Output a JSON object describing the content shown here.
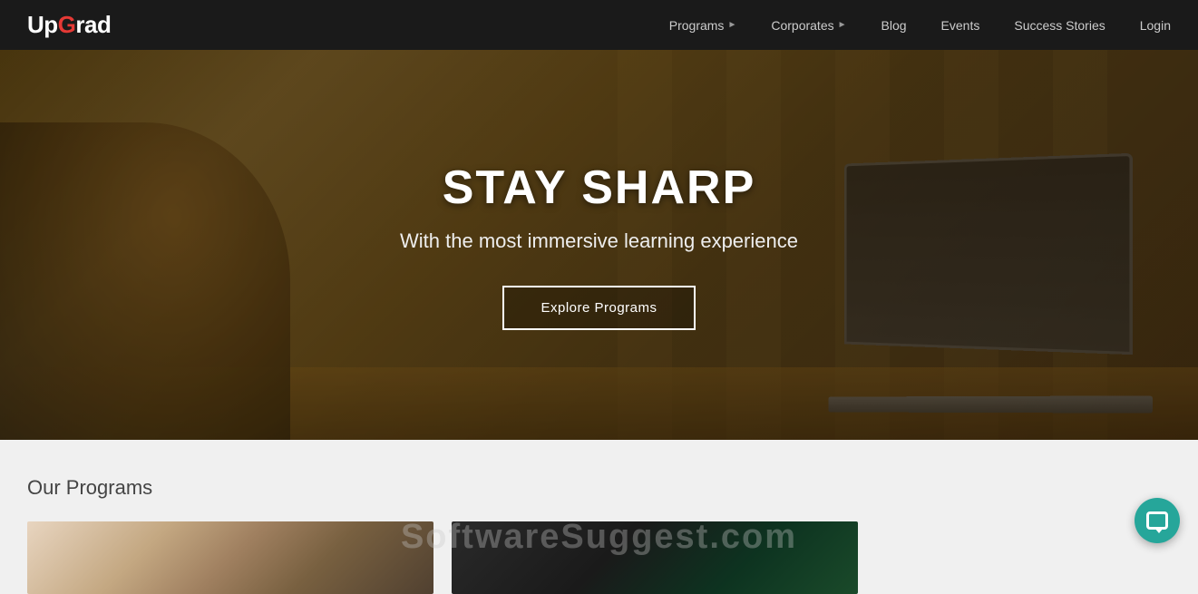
{
  "logo": {
    "part1": "Up",
    "part2": "G",
    "part3": "rad"
  },
  "navbar": {
    "links": [
      {
        "label": "Programs",
        "hasArrow": true,
        "name": "nav-programs"
      },
      {
        "label": "Corporates",
        "hasArrow": true,
        "name": "nav-corporates"
      },
      {
        "label": "Blog",
        "hasArrow": false,
        "name": "nav-blog"
      },
      {
        "label": "Events",
        "hasArrow": false,
        "name": "nav-events"
      },
      {
        "label": "Success Stories",
        "hasArrow": false,
        "name": "nav-success-stories"
      },
      {
        "label": "Login",
        "hasArrow": false,
        "name": "nav-login"
      }
    ]
  },
  "hero": {
    "title": "STAY SHARP",
    "subtitle": "With the most immersive learning experience",
    "button_label": "Explore Programs"
  },
  "programs_section": {
    "title": "Our Programs"
  },
  "watermark": {
    "text": "SoftwareSuggest.com"
  }
}
